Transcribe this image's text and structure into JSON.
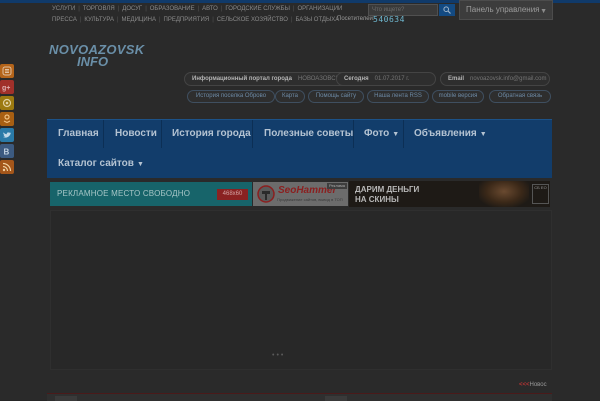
{
  "header": {
    "top_links": [
      "УСЛУГИ",
      "ТОРГОВЛЯ",
      "ДОСУГ",
      "ОБРАЗОВАНИЕ",
      "АВТО",
      "ГОРОДСКИЕ СЛУЖБЫ",
      "ОРГАНИЗАЦИИ",
      "ПРЕССА",
      "КУЛЬТУРА",
      "МЕДИЦИНА",
      "ПРЕДПРИЯТИЯ",
      "СЕЛЬСКОЕ ХОЗЯЙСТВО",
      "БАЗЫ ОТДЫХА"
    ],
    "visits_label": "Посетителей:",
    "visits_count": "540634",
    "search_placeholder": "Что ищете?",
    "panel_button": "Панель управления"
  },
  "logo": {
    "line1": "NOVOAZOVSK",
    "line2": "INFO"
  },
  "info": {
    "portal_label": "Информационный портал города",
    "portal_value": "НОВОАЗОВСК",
    "today_label": "Сегодня",
    "today_value": "01.07.2017 г.",
    "email_label": "Email",
    "email_value": "novoazovsk.info@gmail.com"
  },
  "sub_links": [
    "История поселка Оброво",
    "Карта",
    "Помощь сайту",
    "Наша лента RSS",
    "mobile версия",
    "Обратная связь"
  ],
  "nav": {
    "items": [
      {
        "label": "Главная",
        "dropdown": false
      },
      {
        "label": "Новости",
        "dropdown": false
      },
      {
        "label": "История города",
        "dropdown": false
      },
      {
        "label": "Полезные советы",
        "dropdown": false
      },
      {
        "label": "Фото",
        "dropdown": true
      },
      {
        "label": "Объявления",
        "dropdown": true
      }
    ],
    "catalog": {
      "label": "Каталог сайтов",
      "dropdown": true
    }
  },
  "banners": {
    "ad_free_text": "РЕКЛАМНОЕ   МЕСТО СВОБОДНО",
    "ad_size": "468x60",
    "seo_brand": "SeoHammer",
    "seo_tagline": "Продвижение сайтов, вывод в ТОП",
    "seo_corner": "Реклама",
    "skins_text_1": "ДАРИМ ДЕНЬГИ",
    "skins_text_2": "НА СКИНЫ",
    "skins_logo": "СБ ЕО"
  },
  "ticker": {
    "arrows": "<<<",
    "text": "Новос"
  },
  "social": [
    {
      "name": "blogger",
      "color": "#b4641a"
    },
    {
      "name": "google-plus",
      "color": "#a0302a"
    },
    {
      "name": "mail-ru",
      "color": "#9c7a10"
    },
    {
      "name": "odnoklassniki",
      "color": "#a85f12"
    },
    {
      "name": "twitter",
      "color": "#2a7aa8"
    },
    {
      "name": "vkontakte",
      "color": "#3c5a80"
    },
    {
      "name": "rss",
      "color": "#a4561a"
    }
  ],
  "colors": {
    "nav": "#123d6b",
    "accent": "#134a82",
    "ticker_arrows": "#b23434"
  }
}
